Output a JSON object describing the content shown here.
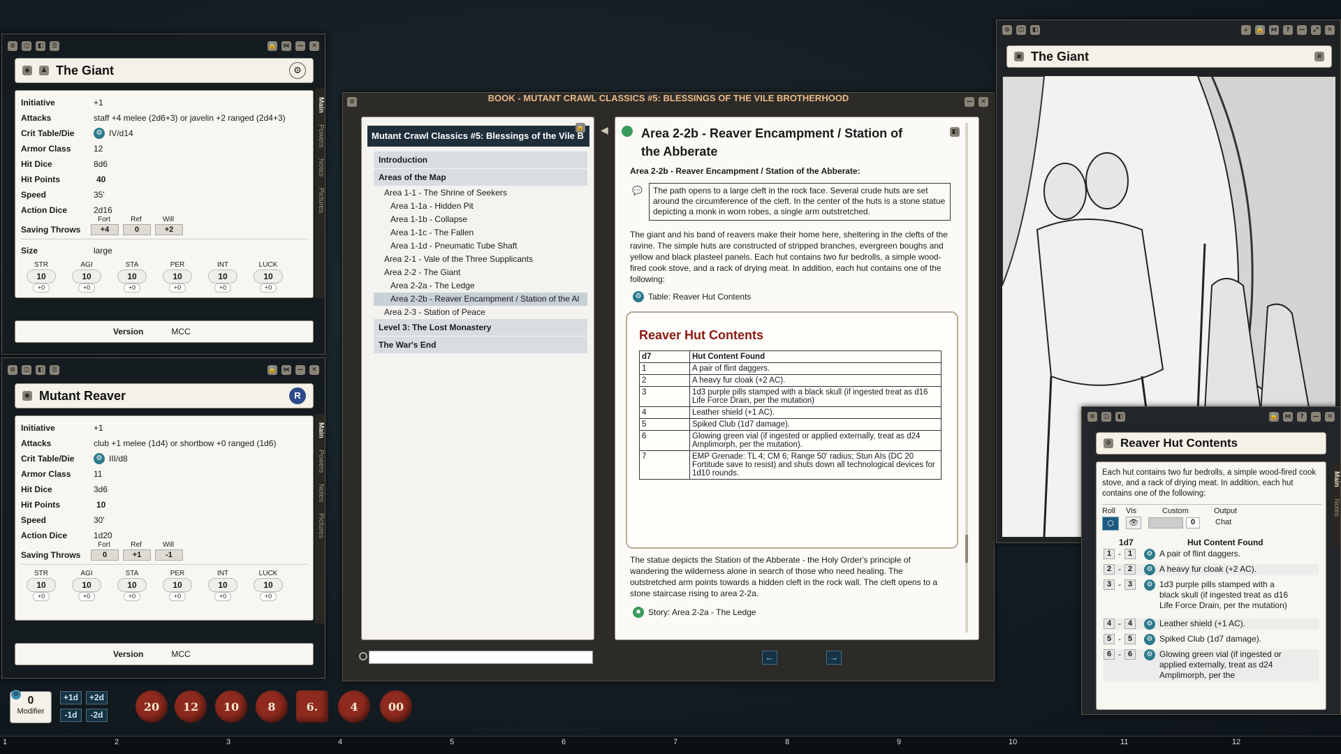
{
  "giant_sheet": {
    "name": "The Giant",
    "stats": [
      {
        "label": "Initiative",
        "value": "+1"
      },
      {
        "label": "Attacks",
        "value": "staff +4 melee (2d6+3) or javelin +2 ranged (2d4+3)"
      },
      {
        "label": "Crit Table/Die",
        "value": "IV/d14"
      },
      {
        "label": "Armor Class",
        "value": "12"
      },
      {
        "label": "Hit Dice",
        "value": "8d6"
      },
      {
        "label": "Hit Points",
        "value": "40"
      },
      {
        "label": "Speed",
        "value": "35'"
      },
      {
        "label": "Action Dice",
        "value": "2d16"
      }
    ],
    "saves_label": "Saving Throws",
    "save_headers": [
      "Fort",
      "Ref",
      "Will"
    ],
    "saves": [
      "+4",
      "0",
      "+2"
    ],
    "size_label": "Size",
    "size": "large",
    "abilities": [
      {
        "name": "STR",
        "value": "10",
        "mod": "+0"
      },
      {
        "name": "AGI",
        "value": "10",
        "mod": "+0"
      },
      {
        "name": "STA",
        "value": "10",
        "mod": "+0"
      },
      {
        "name": "PER",
        "value": "10",
        "mod": "+0"
      },
      {
        "name": "INT",
        "value": "10",
        "mod": "+0"
      },
      {
        "name": "LUCK",
        "value": "10",
        "mod": "+0"
      }
    ],
    "version_label": "Version",
    "version": "MCC",
    "tabs": [
      "Main",
      "Powers",
      "Notes",
      "Pictures"
    ]
  },
  "reaver_sheet": {
    "name": "Mutant Reaver",
    "badge": "R",
    "stats": [
      {
        "label": "Initiative",
        "value": "+1"
      },
      {
        "label": "Attacks",
        "value": "club +1 melee (1d4) or shortbow +0 ranged (1d6)"
      },
      {
        "label": "Crit Table/Die",
        "value": "III/d8"
      },
      {
        "label": "Armor Class",
        "value": "11"
      },
      {
        "label": "Hit Dice",
        "value": "3d6"
      },
      {
        "label": "Hit Points",
        "value": "10"
      },
      {
        "label": "Speed",
        "value": "30'"
      },
      {
        "label": "Action Dice",
        "value": "1d20"
      }
    ],
    "saves_label": "Saving Throws",
    "save_headers": [
      "Fort",
      "Ref",
      "Will"
    ],
    "saves": [
      "0",
      "+1",
      "-1"
    ],
    "abilities": [
      {
        "name": "STR",
        "value": "10",
        "mod": "+0"
      },
      {
        "name": "AGI",
        "value": "10",
        "mod": "+0"
      },
      {
        "name": "STA",
        "value": "10",
        "mod": "+0"
      },
      {
        "name": "PER",
        "value": "10",
        "mod": "+0"
      },
      {
        "name": "INT",
        "value": "10",
        "mod": "+0"
      },
      {
        "name": "LUCK",
        "value": "10",
        "mod": "+0"
      }
    ],
    "version_label": "Version",
    "version": "MCC",
    "tabs": [
      "Main",
      "Powers",
      "Notes",
      "Pictures"
    ]
  },
  "book": {
    "title": "BOOK - MUTANT CRAWL CLASSICS #5: BLESSINGS OF THE VILE BROTHERHOOD",
    "toc_title": "Mutant Crawl Classics #5: Blessings of the Vile B",
    "toc": [
      {
        "text": "Introduction",
        "type": "cat"
      },
      {
        "text": "Areas of the Map",
        "type": "cat"
      },
      {
        "text": "Area 1-1 - The Shrine of Seekers",
        "type": "l1"
      },
      {
        "text": "Area 1-1a - Hidden Pit",
        "type": "l2"
      },
      {
        "text": "Area 1-1b - Collapse",
        "type": "l2"
      },
      {
        "text": "Area 1-1c - The Fallen",
        "type": "l2"
      },
      {
        "text": "Area 1-1d - Pneumatic Tube Shaft",
        "type": "l2"
      },
      {
        "text": "Area 2-1 - Vale of the Three Supplicants",
        "type": "l1"
      },
      {
        "text": "Area 2-2 - The Giant",
        "type": "l1"
      },
      {
        "text": "Area 2-2a - The Ledge",
        "type": "l2"
      },
      {
        "text": "Area 2-2b - Reaver Encampment / Station of the Al",
        "type": "l2sel"
      },
      {
        "text": "Area 2-3 - Station of Peace",
        "type": "l1"
      },
      {
        "text": "Level 3: The Lost Monastery",
        "type": "cat"
      },
      {
        "text": "The War's End",
        "type": "cat"
      }
    ],
    "page_title": "Area 2-2b - Reaver Encampment / Station of the Abberate",
    "subhead": "Area 2-2b - Reaver Encampment / Station of the Abberate:",
    "boxed_text": "The path opens to a large cleft in the rock face. Several crude huts are set around the circumference of the cleft. In the center of the huts is a stone statue depicting a monk in worn robes, a single arm outstretched.",
    "para1": "The giant and his band of reavers make their home here, sheltering in the clefts of the ravine. The simple huts are constructed of stripped branches, evergreen boughs and yellow and black plasteel panels. Each hut contains two fur bedrolls, a simple wood-fired cook stove, and a rack of drying meat. In addition, each hut contains one of the following:",
    "table_link": "Table: Reaver Hut Contents",
    "table_title": "Reaver Hut Contents",
    "table_headers": [
      "d7",
      "Hut Content Found"
    ],
    "table_rows": [
      [
        "1",
        "A pair of flint daggers."
      ],
      [
        "2",
        "A heavy fur cloak (+2 AC)."
      ],
      [
        "3",
        "1d3 purple pills stamped with a black skull (if ingested treat as d16 Life Force Drain, per the mutation)"
      ],
      [
        "4",
        "Leather shield (+1 AC)."
      ],
      [
        "5",
        "Spiked Club (1d7 damage)."
      ],
      [
        "6",
        "Glowing green vial (if ingested or applied externally, treat as d24 Amplimorph, per the mutation)."
      ],
      [
        "7",
        "EMP Grenade: TL 4; CM 6; Range 50' radius; Stun AIs (DC 20 Fortitude save to resist) and shuts down all technological devices for 1d10 rounds."
      ]
    ],
    "para2": "The statue depicts the Station of the Abberate - the Holy Order's principle of wandering the wilderness alone in search of those who need healing. The outstretched arm points towards a hidden cleft in the rock wall. The cleft opens to a stone staircase rising to area 2-2a.",
    "story_link": "Story: Area 2-2a - The Ledge",
    "search_placeholder": ""
  },
  "image_window": {
    "title": "The Giant"
  },
  "hut_window": {
    "title": "Reaver Hut Contents",
    "description": "Each hut contains two fur bedrolls, a simple wood-fired cook stove, and a rack of drying meat. In addition, each hut contains one of the following:",
    "col_roll": "Roll",
    "col_vis": "Vis",
    "col_custom": "Custom",
    "col_output": "Output",
    "custom_value": "0",
    "output_value": "Chat",
    "die_label": "1d7",
    "col_content": "Hut Content Found",
    "rows": [
      {
        "from": "1",
        "to": "1",
        "text": "A pair of flint daggers."
      },
      {
        "from": "2",
        "to": "2",
        "text": "A heavy fur cloak (+2 AC)."
      },
      {
        "from": "3",
        "to": "3",
        "text": "1d3 purple pills stamped with a black skull (if ingested treat as d16 Life Force Drain, per the mutation)"
      },
      {
        "from": "4",
        "to": "4",
        "text": "Leather shield (+1 AC)."
      },
      {
        "from": "5",
        "to": "5",
        "text": "Spiked Club (1d7 damage)."
      },
      {
        "from": "6",
        "to": "6",
        "text": "Glowing green vial (if ingested or applied externally, treat as d24 Amplimorph, per the"
      }
    ],
    "tabs": [
      "Main",
      "Notes"
    ]
  },
  "modifier": {
    "value": "0",
    "label": "Modifier",
    "buttons": [
      "+1d",
      "+2d",
      "-1d",
      "-2d"
    ]
  },
  "dice": [
    "20",
    "12",
    "10",
    "8",
    "6.",
    "4",
    "00"
  ],
  "hotbar": [
    "1",
    "2",
    "3",
    "4",
    "5",
    "6",
    "7",
    "8",
    "9",
    "10",
    "11",
    "12"
  ],
  "colors": {
    "link": "#2b7a8c",
    "table_title": "#8b1a14",
    "dice": "#8e2a1e",
    "toc_header": "#1e2f3a"
  }
}
